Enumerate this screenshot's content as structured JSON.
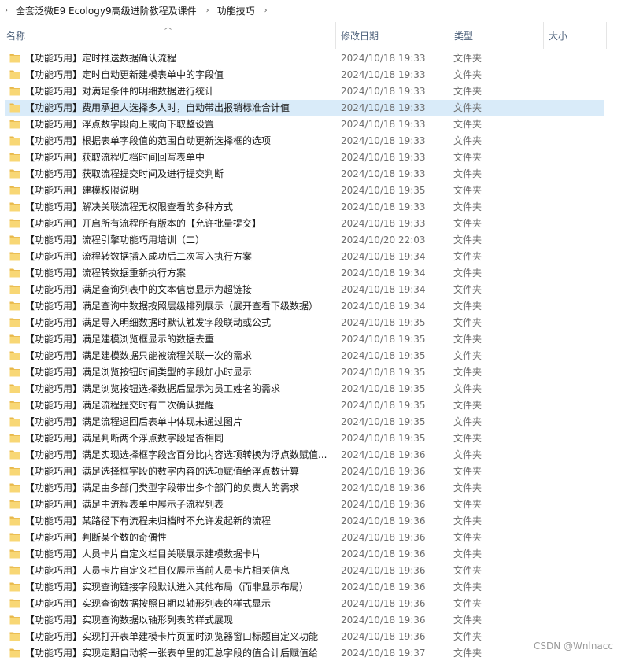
{
  "breadcrumb": {
    "parts": [
      "全套泛微E9 Ecology9高级进阶教程及课件",
      "功能技巧"
    ]
  },
  "columns": {
    "name": "名称",
    "date": "修改日期",
    "type": "类型",
    "size": "大小"
  },
  "files": [
    {
      "name": "【功能巧用】定时推送数据确认流程",
      "date": "2024/10/18 19:33",
      "type": "文件夹"
    },
    {
      "name": "【功能巧用】定时自动更新建模表单中的字段值",
      "date": "2024/10/18 19:33",
      "type": "文件夹"
    },
    {
      "name": "【功能巧用】对满足条件的明细数据进行统计",
      "date": "2024/10/18 19:33",
      "type": "文件夹"
    },
    {
      "name": "【功能巧用】费用承担人选择多人时，自动带出报销标准合计值",
      "date": "2024/10/18 19:33",
      "type": "文件夹",
      "selected": true
    },
    {
      "name": "【功能巧用】浮点数字段向上或向下取整设置",
      "date": "2024/10/18 19:33",
      "type": "文件夹"
    },
    {
      "name": "【功能巧用】根据表单字段值的范围自动更新选择框的选项",
      "date": "2024/10/18 19:33",
      "type": "文件夹"
    },
    {
      "name": "【功能巧用】获取流程归档时间回写表单中",
      "date": "2024/10/18 19:33",
      "type": "文件夹"
    },
    {
      "name": "【功能巧用】获取流程提交时间及进行提交判断",
      "date": "2024/10/18 19:33",
      "type": "文件夹"
    },
    {
      "name": "【功能巧用】建模权限说明",
      "date": "2024/10/18 19:35",
      "type": "文件夹"
    },
    {
      "name": "【功能巧用】解决关联流程无权限查看的多种方式",
      "date": "2024/10/18 19:33",
      "type": "文件夹"
    },
    {
      "name": "【功能巧用】开启所有流程所有版本的【允许批量提交】",
      "date": "2024/10/18 19:33",
      "type": "文件夹"
    },
    {
      "name": "【功能巧用】流程引擎功能巧用培训（二）",
      "date": "2024/10/20 22:03",
      "type": "文件夹"
    },
    {
      "name": "【功能巧用】流程转数据插入成功后二次写入执行方案",
      "date": "2024/10/18 19:34",
      "type": "文件夹"
    },
    {
      "name": "【功能巧用】流程转数据重新执行方案",
      "date": "2024/10/18 19:34",
      "type": "文件夹"
    },
    {
      "name": "【功能巧用】满足查询列表中的文本信息显示为超链接",
      "date": "2024/10/18 19:34",
      "type": "文件夹"
    },
    {
      "name": "【功能巧用】满足查询中数据按照层级排列展示（展开查看下级数据）",
      "date": "2024/10/18 19:34",
      "type": "文件夹"
    },
    {
      "name": "【功能巧用】满足导入明细数据时默认触发字段联动或公式",
      "date": "2024/10/18 19:35",
      "type": "文件夹"
    },
    {
      "name": "【功能巧用】满足建模浏览框显示的数据去重",
      "date": "2024/10/18 19:35",
      "type": "文件夹"
    },
    {
      "name": "【功能巧用】满足建模数据只能被流程关联一次的需求",
      "date": "2024/10/18 19:35",
      "type": "文件夹"
    },
    {
      "name": "【功能巧用】满足浏览按钮时间类型的字段加小时显示",
      "date": "2024/10/18 19:35",
      "type": "文件夹"
    },
    {
      "name": "【功能巧用】满足浏览按钮选择数据后显示为员工姓名的需求",
      "date": "2024/10/18 19:35",
      "type": "文件夹"
    },
    {
      "name": "【功能巧用】满足流程提交时有二次确认提醒",
      "date": "2024/10/18 19:35",
      "type": "文件夹"
    },
    {
      "name": "【功能巧用】满足流程退回后表单中体现未通过图片",
      "date": "2024/10/18 19:35",
      "type": "文件夹"
    },
    {
      "name": "【功能巧用】满足判断两个浮点数字段是否相同",
      "date": "2024/10/18 19:35",
      "type": "文件夹"
    },
    {
      "name": "【功能巧用】满足实现选择框字段含百分比内容选项转换为浮点数赋值...",
      "date": "2024/10/18 19:36",
      "type": "文件夹"
    },
    {
      "name": "【功能巧用】满足选择框字段的数字内容的选项赋值给浮点数计算",
      "date": "2024/10/18 19:36",
      "type": "文件夹"
    },
    {
      "name": "【功能巧用】满足由多部门类型字段带出多个部门的负责人的需求",
      "date": "2024/10/18 19:36",
      "type": "文件夹"
    },
    {
      "name": "【功能巧用】满足主流程表单中展示子流程列表",
      "date": "2024/10/18 19:36",
      "type": "文件夹"
    },
    {
      "name": "【功能巧用】某路径下有流程未归档时不允许发起新的流程",
      "date": "2024/10/18 19:36",
      "type": "文件夹"
    },
    {
      "name": "【功能巧用】判断某个数的奇偶性",
      "date": "2024/10/18 19:36",
      "type": "文件夹"
    },
    {
      "name": "【功能巧用】人员卡片自定义栏目关联展示建模数据卡片",
      "date": "2024/10/18 19:36",
      "type": "文件夹"
    },
    {
      "name": "【功能巧用】人员卡片自定义栏目仅展示当前人员卡片相关信息",
      "date": "2024/10/18 19:36",
      "type": "文件夹"
    },
    {
      "name": "【功能巧用】实现查询链接字段默认进入其他布局（而非显示布局）",
      "date": "2024/10/18 19:36",
      "type": "文件夹"
    },
    {
      "name": "【功能巧用】实现查询数据按照日期以轴形列表的样式显示",
      "date": "2024/10/18 19:36",
      "type": "文件夹"
    },
    {
      "name": "【功能巧用】实现查询数据以轴形列表的样式展现",
      "date": "2024/10/18 19:36",
      "type": "文件夹"
    },
    {
      "name": "【功能巧用】实现打开表单建模卡片页面时浏览器窗口标题自定义功能",
      "date": "2024/10/18 19:36",
      "type": "文件夹"
    },
    {
      "name": "【功能巧用】实现定期自动将一张表单里的汇总字段的值合计后赋值给",
      "date": "2024/10/18 19:37",
      "type": "文件夹"
    }
  ],
  "watermark": "CSDN @Wnlnacc",
  "colors": {
    "selected": "#d9ebf9",
    "header_text": "#4c607a",
    "folder": "#f8d775"
  }
}
